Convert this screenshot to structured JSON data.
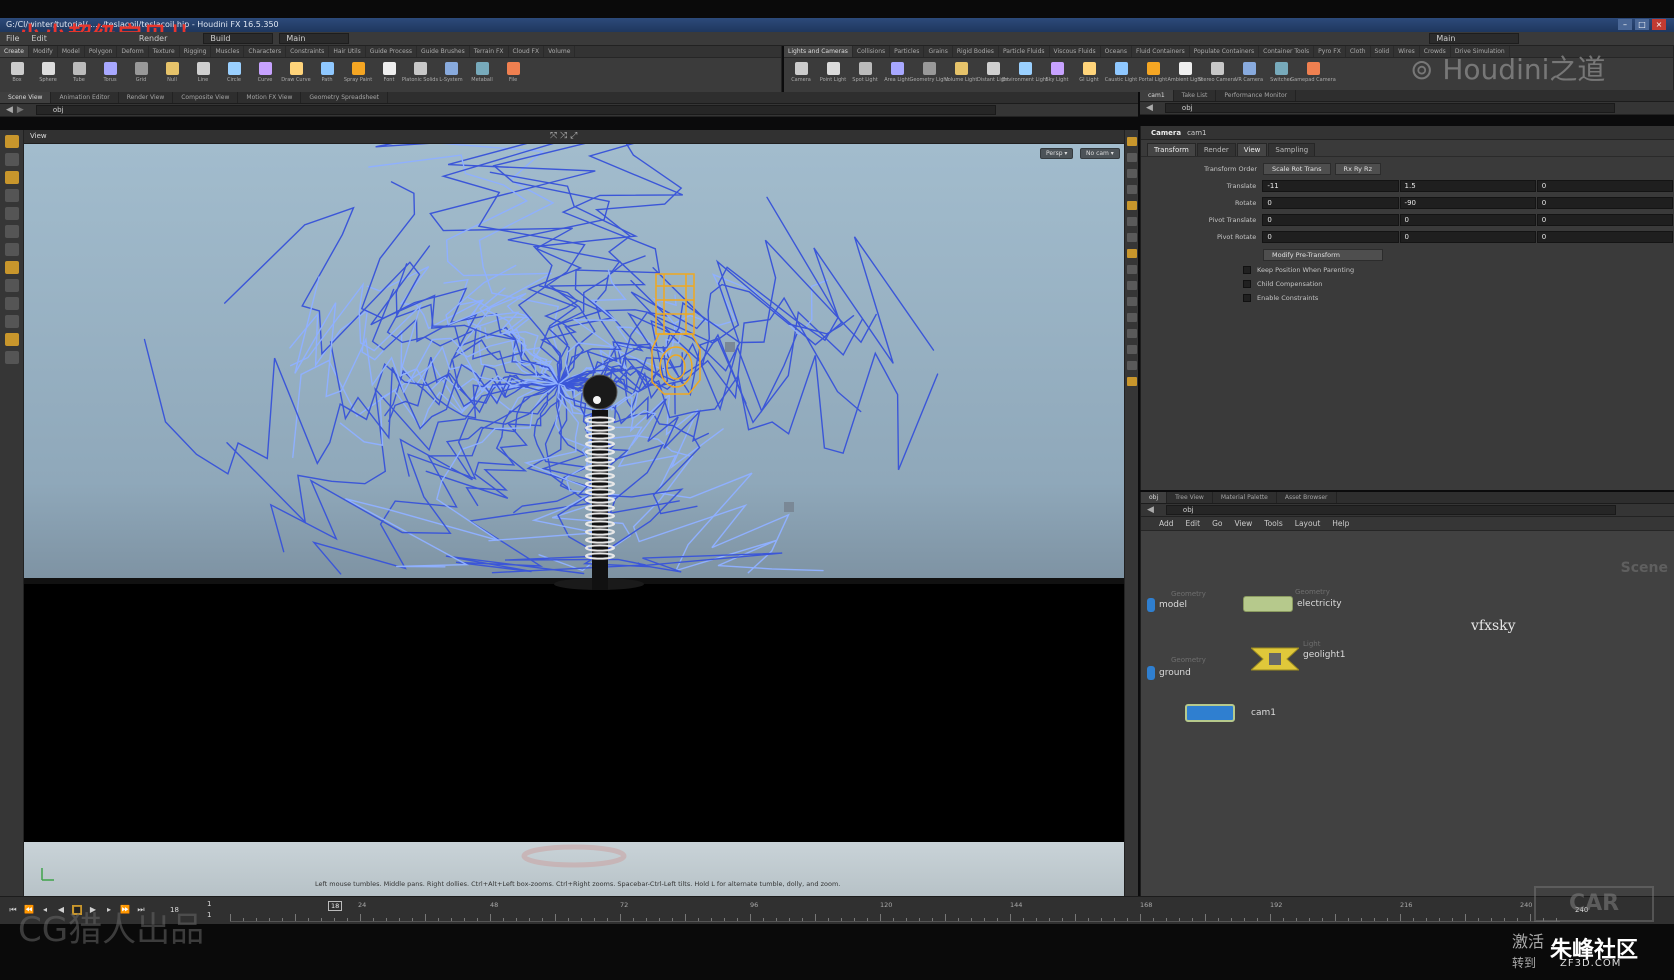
{
  "window": {
    "title": "G:/Cl/winter/tutorial/....../teslacoil/teslacoil.hip - Houdini FX 16.5.350"
  },
  "watermarks": {
    "top_left": "小小超级宝贝儿",
    "logo": "Houdini之道",
    "bottom_left": "CG猎人出品",
    "bottom_right": "朱峰社区",
    "bottom_right_url": "ZF3D.COM",
    "bottom_right_2": "激活",
    "bottom_right_3": "转到"
  },
  "menubar": {
    "items": [
      "File",
      "Edit",
      "Render"
    ],
    "desktop": "Build",
    "workspace": "Main",
    "right_workspace": "Main"
  },
  "shelf_left": {
    "tabs": [
      "Create",
      "Modify",
      "Model",
      "Polygon",
      "Deform",
      "Texture",
      "Rigging",
      "Muscles",
      "Characters",
      "Constraints",
      "Hair Utils",
      "Guide Process",
      "Guide Brushes",
      "Terrain FX",
      "Cloud FX",
      "Volume"
    ],
    "tools": [
      "Box",
      "Sphere",
      "Tube",
      "Torus",
      "Grid",
      "Null",
      "Line",
      "Circle",
      "Curve",
      "Draw Curve",
      "Path",
      "Spray Paint",
      "Font",
      "Platonic Solids",
      "L-System",
      "Metaball",
      "File"
    ]
  },
  "shelf_right": {
    "tabs": [
      "Lights and Cameras",
      "Collisions",
      "Particles",
      "Grains",
      "Rigid Bodies",
      "Particle Fluids",
      "Viscous Fluids",
      "Oceans",
      "Fluid Containers",
      "Populate Containers",
      "Container Tools",
      "Pyro FX",
      "Cloth",
      "Solid",
      "Wires",
      "Crowds",
      "Drive Simulation"
    ],
    "tools": [
      "Camera",
      "Point Light",
      "Spot Light",
      "Area Light",
      "Geometry Light",
      "Volume Light",
      "Distant Light",
      "Environment Light",
      "Sky Light",
      "GI Light",
      "Caustic Light",
      "Portal Light",
      "Ambient Light",
      "Stereo Camera",
      "VR Camera",
      "Switcher",
      "Gamepad Camera"
    ]
  },
  "left_tabs": [
    "Scene View",
    "Animation Editor",
    "Render View",
    "Composite View",
    "Motion FX View",
    "Geometry Spreadsheet"
  ],
  "left_path": "obj",
  "viewport": {
    "label": "View",
    "persp": "Persp ▾",
    "cam": "No cam ▾",
    "hint": "Left mouse tumbles. Middle pans. Right dollies. Ctrl+Alt+Left box-zooms. Ctrl+Right zooms. Spacebar-Ctrl-Left tilts. Hold L for alternate tumble, dolly, and zoom."
  },
  "right_tabs": [
    "cam1",
    "Take List",
    "Performance Monitor"
  ],
  "right_path": "obj",
  "params": {
    "op_type": "Camera",
    "op_name": "cam1",
    "tabs": [
      "Transform",
      "Render",
      "View",
      "Sampling"
    ],
    "transform_order_label": "Transform Order",
    "transform_order": "Scale Rot Trans",
    "rot_order": "Rx Ry Rz",
    "rows": [
      {
        "label": "Translate",
        "values": [
          "-11",
          "1.5",
          "0"
        ]
      },
      {
        "label": "Rotate",
        "values": [
          "0",
          "-90",
          "0"
        ]
      },
      {
        "label": "Pivot Translate",
        "values": [
          "0",
          "0",
          "0"
        ]
      },
      {
        "label": "Pivot Rotate",
        "values": [
          "0",
          "0",
          "0"
        ]
      }
    ],
    "modify_pre": "Modify Pre-Transform",
    "checks": [
      "Keep Position When Parenting",
      "Child Compensation",
      "Enable Constraints"
    ]
  },
  "network": {
    "tabs": [
      "obj",
      "Tree View",
      "Material Palette",
      "Asset Browser"
    ],
    "path": "obj",
    "menu": [
      "Add",
      "Edit",
      "Go",
      "View",
      "Tools",
      "Layout",
      "Help"
    ],
    "scene_label": "Scene",
    "sky_label": "vfxsky",
    "nodes": [
      {
        "type": "Geometry",
        "name": "model"
      },
      {
        "type": "Geometry",
        "name": "electricity"
      },
      {
        "type": "Geometry",
        "name": "ground"
      },
      {
        "type": "Light",
        "name": "geolight1"
      },
      {
        "type": "",
        "name": "cam1"
      }
    ]
  },
  "timeline": {
    "frame": "18",
    "start": "1",
    "start2": "1",
    "ticks": [
      "18",
      "24",
      "48",
      "72",
      "96",
      "120",
      "144",
      "168",
      "192",
      "216",
      "240"
    ],
    "end": "240"
  },
  "colors": {
    "accent": "#c8962c",
    "camera_wire": "#f0a820",
    "electric": "#3b56d8",
    "node_blue": "#2f7fd0"
  }
}
